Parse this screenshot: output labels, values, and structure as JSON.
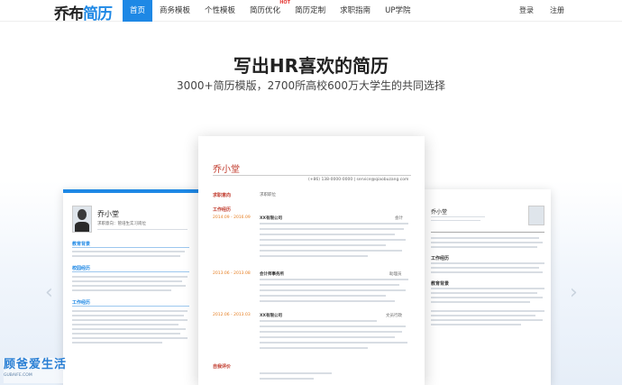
{
  "logo": {
    "part1": "乔布",
    "part2": "简历"
  },
  "nav": [
    {
      "label": "首页",
      "active": true
    },
    {
      "label": "商务模板"
    },
    {
      "label": "个性模板"
    },
    {
      "label": "简历优化",
      "badge": "HOT"
    },
    {
      "label": "简历定制"
    },
    {
      "label": "求职指南"
    },
    {
      "label": "UP学院"
    }
  ],
  "auth": {
    "login": "登录",
    "register": "注册"
  },
  "hero": {
    "title": "写出HR喜欢的简历",
    "subtitle": "3000+简历模版，2700所高校600万大学生的共同选择"
  },
  "resume_center": {
    "name": "乔小堂",
    "contact": "(+86) 138-0000-0000 | service@qiaobuzang.com",
    "sections": {
      "intent": "求职意向",
      "intent_value": "求职职位",
      "work": "工作经历",
      "self": "自我评价"
    },
    "jobs": [
      {
        "date": "2014.09 - 2016.09",
        "company": "XX有限公司",
        "role": "会计"
      },
      {
        "date": "2013.06 - 2013.08",
        "company": "会计师事务所",
        "role": "助理员"
      },
      {
        "date": "2012.06 - 2013.03",
        "company": "XX有限公司",
        "role": "文员行政"
      }
    ]
  },
  "resume_left": {
    "name": "乔小堂",
    "title": "求职意向：管培生实习岗位",
    "sections": [
      "教育背景",
      "校园经历",
      "工作经历"
    ]
  },
  "resume_right": {
    "name": "乔小堂",
    "sections": [
      "工作经历",
      "教育背景"
    ]
  },
  "arrows": {
    "prev": "‹",
    "next": "›"
  },
  "watermark": {
    "text": "顾爸爱生活",
    "url": "GUBAIFE.COM"
  }
}
